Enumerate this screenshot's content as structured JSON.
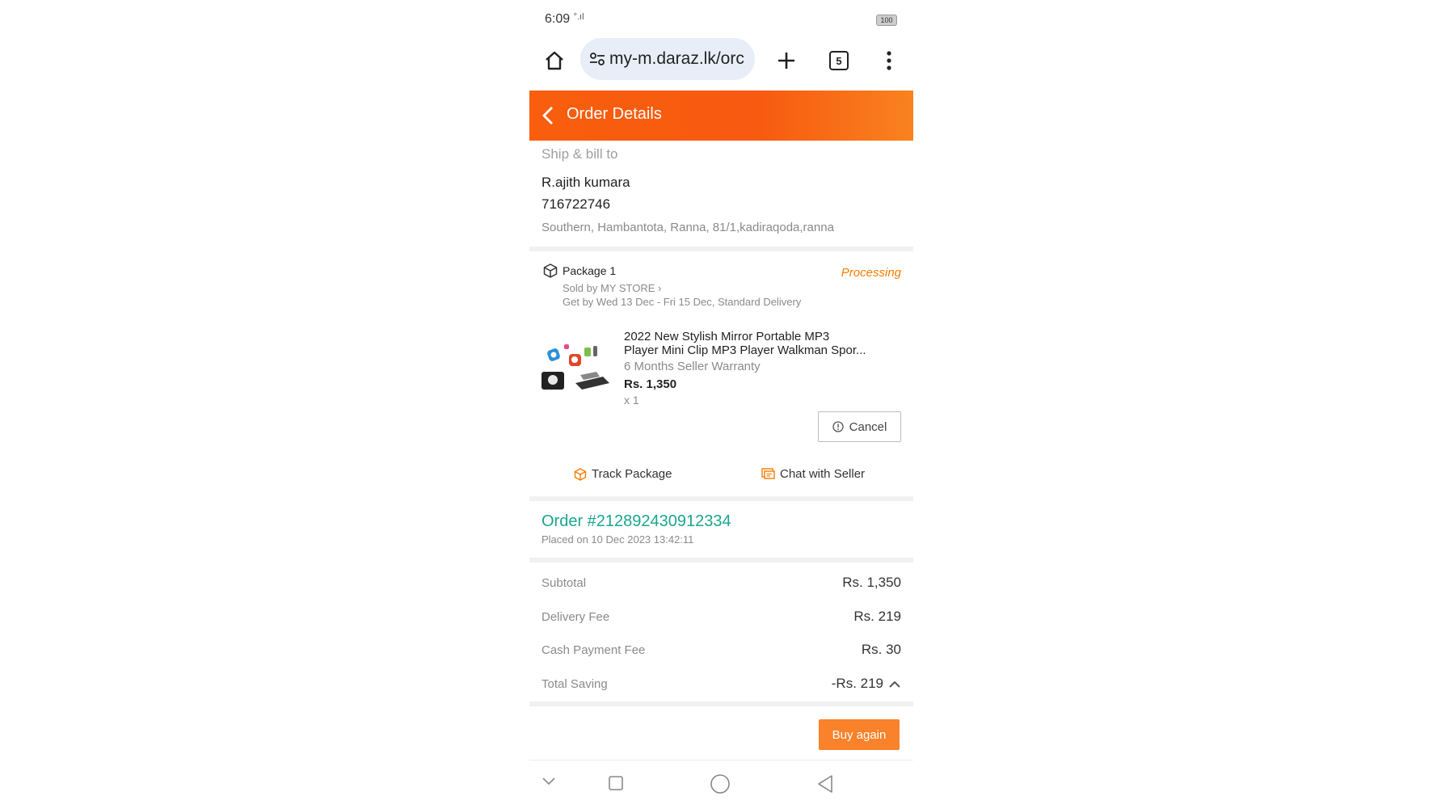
{
  "status_bar": {
    "time": "6:09",
    "signal": "°.ıl",
    "battery": "100"
  },
  "browser": {
    "url": "my-m.daraz.lk/orc",
    "tab_count": "5"
  },
  "header": {
    "title": "Order Details"
  },
  "ship": {
    "label": "Ship & bill to",
    "name": "R.ajith kumara",
    "phone": "716722746",
    "address": "Southern, Hambantota, Ranna, 81/1,kadiraqoda,ranna"
  },
  "package": {
    "title": "Package 1",
    "status": "Processing",
    "seller": "Sold by MY STORE ›",
    "delivery": "Get by Wed 13 Dec - Fri 15 Dec, Standard Delivery",
    "product": {
      "name_line1": "2022 New Stylish Mirror Portable MP3",
      "name_line2": "Player Mini Clip MP3 Player Walkman Spor...",
      "warranty": "6 Months Seller Warranty",
      "price": "Rs. 1,350",
      "qty": "x 1"
    },
    "cancel_label": "Cancel",
    "track_label": "Track Package",
    "chat_label": "Chat with Seller"
  },
  "order": {
    "number": "Order #212892430912334",
    "placed": "Placed on 10 Dec 2023 13:42:11"
  },
  "summary": [
    {
      "label": "Subtotal",
      "value": "Rs. 1,350"
    },
    {
      "label": "Delivery Fee",
      "value": "Rs. 219"
    },
    {
      "label": "Cash Payment Fee",
      "value": "Rs. 30"
    },
    {
      "label": "Total Saving",
      "value": "-Rs. 219"
    }
  ],
  "buy_again_label": "Buy again",
  "colors": {
    "brand_orange": "#f95e0e",
    "status_orange": "#f57c00",
    "order_teal": "#1aa58f",
    "buy_orange": "#f9822a"
  }
}
